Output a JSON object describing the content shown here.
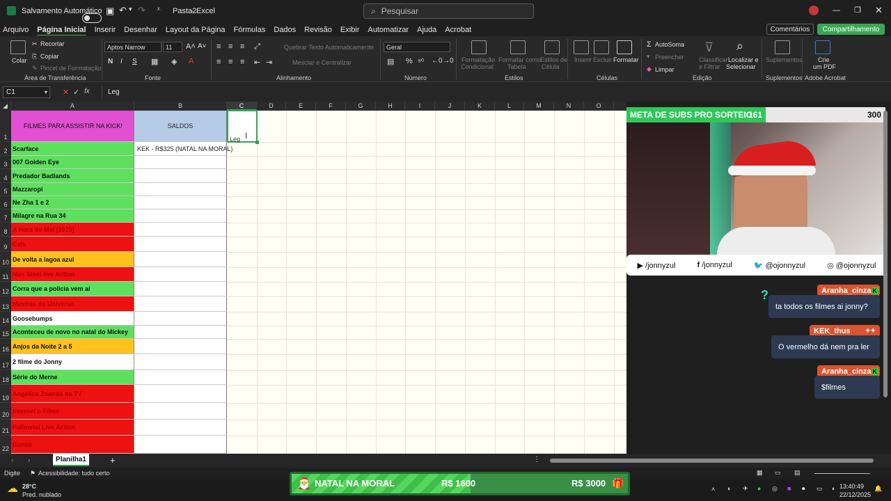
{
  "titlebar": {
    "autosave_label": "Salvamento Automático",
    "doc_title": "Pasta2",
    "app_name": "Excel",
    "separator": "-",
    "search_placeholder": "Pesquisar"
  },
  "menu": {
    "tabs": [
      "Arquivo",
      "Página Inicial",
      "Inserir",
      "Desenhar",
      "Layout da Página",
      "Fórmulas",
      "Dados",
      "Revisão",
      "Exibir",
      "Automatizar",
      "Ajuda",
      "Acrobat"
    ],
    "active": "Página Inicial",
    "comments": "Comentários",
    "share": "Compartilhamento"
  },
  "ribbon": {
    "paste": "Colar",
    "cut": "Recortar",
    "copy": "Copiar",
    "format_painter": "Pincel de Formatação",
    "clipboard_group": "Área de Transferência",
    "font_name": "Aptos Narrow",
    "font_size": "11",
    "bold": "N",
    "italic": "I",
    "underline": "S",
    "font_group": "Fonte",
    "wrap_text": "Quebrar Texto Automaticamente",
    "merge_center": "Mesclar e Centralizar",
    "alignment_group": "Alinhamento",
    "number_format": "Geral",
    "number_group": "Número",
    "cond_format_1": "Formatação",
    "cond_format_2": "Condicional",
    "format_table_1": "Formatar como",
    "format_table_2": "Tabela",
    "cell_styles_1": "Estilos de",
    "cell_styles_2": "Célula",
    "styles_group": "Estilos",
    "insert": "Inserir",
    "delete": "Excluir",
    "format": "Formatar",
    "cells_group": "Células",
    "autosum": "AutoSoma",
    "fill": "Preencher",
    "clear": "Limpar",
    "sort_filter_1": "Classificar",
    "sort_filter_2": "e Filtrar",
    "find_select_1": "Localizar e",
    "find_select_2": "Selecionar",
    "edit_group": "Edição",
    "addins": "Suplementos",
    "addins_group": "Suplementos",
    "create_pdf_1": "Crie",
    "create_pdf_2": "um PDF",
    "acrobat_group": "Adobe Acrobat"
  },
  "formula": {
    "namebox": "C1",
    "content": "Leg"
  },
  "columns": [
    "A",
    "B",
    "C",
    "D",
    "E",
    "F",
    "G",
    "H",
    "I",
    "J",
    "K",
    "L",
    "M",
    "N",
    "O"
  ],
  "cells": {
    "A1": "FILMES PARA ASSISTIR NA KICK!",
    "B1": "SALDOS",
    "C1": "Leg",
    "B2": "KEK - R$325 (NATAL NA MORAL)"
  },
  "rows": [
    {
      "n": "2",
      "title": "Scarface",
      "color": "green"
    },
    {
      "n": "3",
      "title": "007 Golden Eye",
      "color": "green"
    },
    {
      "n": "4",
      "title": "Predador Badlands",
      "color": "green"
    },
    {
      "n": "5",
      "title": "Mazzaropi",
      "color": "green"
    },
    {
      "n": "6",
      "title": "Ne Zha 1 e 2",
      "color": "green"
    },
    {
      "n": "7",
      "title": "Milagre na Rua 34",
      "color": "green"
    },
    {
      "n": "8",
      "title": "A Hora do Mal (2025)",
      "color": "red"
    },
    {
      "n": "9",
      "title": "Cats",
      "color": "red"
    },
    {
      "n": "10",
      "title": "De volta a lagoa azul",
      "color": "orange"
    },
    {
      "n": "11",
      "title": "Max Steel live Action",
      "color": "red"
    },
    {
      "n": "12",
      "title": "Corra que a policia vem ai",
      "color": "green"
    },
    {
      "n": "13",
      "title": "Mestres do Universo",
      "color": "red"
    },
    {
      "n": "14",
      "title": "Goosebumps",
      "color": "white"
    },
    {
      "n": "15",
      "title": "Aconteceu de novo no natal do Mickey",
      "color": "green"
    },
    {
      "n": "16",
      "title": "Anjos da Noite 2 a 5",
      "color": "orange"
    },
    {
      "n": "17",
      "title": "2 filme do Jonny",
      "color": "white"
    },
    {
      "n": "18",
      "title": "Série do Merne",
      "color": "green"
    },
    {
      "n": "19",
      "title": "Angélica Zoando na TV",
      "color": "red"
    },
    {
      "n": "20",
      "title": "Internet o Filme",
      "color": "red"
    },
    {
      "n": "21",
      "title": "Fullmetal Live Action",
      "color": "red"
    },
    {
      "n": "22",
      "title": "Bambi",
      "color": "red"
    }
  ],
  "sheet": {
    "tab": "Planilha1",
    "status": "Digite",
    "accessibility": "Acessibilidade: tudo certo"
  },
  "overlay": {
    "goal_label": "META DE SUBS PRO SORTEIO",
    "goal_current": "161",
    "goal_target": "300",
    "goal_fraction": 0.537,
    "socials": [
      "/jonnyzul",
      "/jonnyzul",
      "@ojonnyzul",
      "@ojonnyzul"
    ],
    "chat": [
      {
        "user": "Aranha_cinza",
        "msg": "ta todos os filmes ai jonny?"
      },
      {
        "user": "KEK_thus",
        "msg": "O vermelho dá nem pra ler"
      },
      {
        "user": "Aranha_cinza",
        "msg": "$filmes"
      }
    ],
    "chat_icon": "?",
    "natal_label": "NATAL NA MORAL",
    "natal_current": "R$ 1600",
    "natal_target": "R$ 3000",
    "natal_fraction": 0.533
  },
  "taskbar": {
    "temp": "28°C",
    "weather": "Pred. nublado",
    "time": "13:40:49",
    "date": "22/12/2025"
  },
  "colors": {
    "accent": "#36a35a",
    "green_row": "#5ee05e",
    "red_row": "#ee1111",
    "orange_row": "#ffc21a",
    "header_a": "#e14fd2",
    "header_b": "#b5cbe6"
  }
}
